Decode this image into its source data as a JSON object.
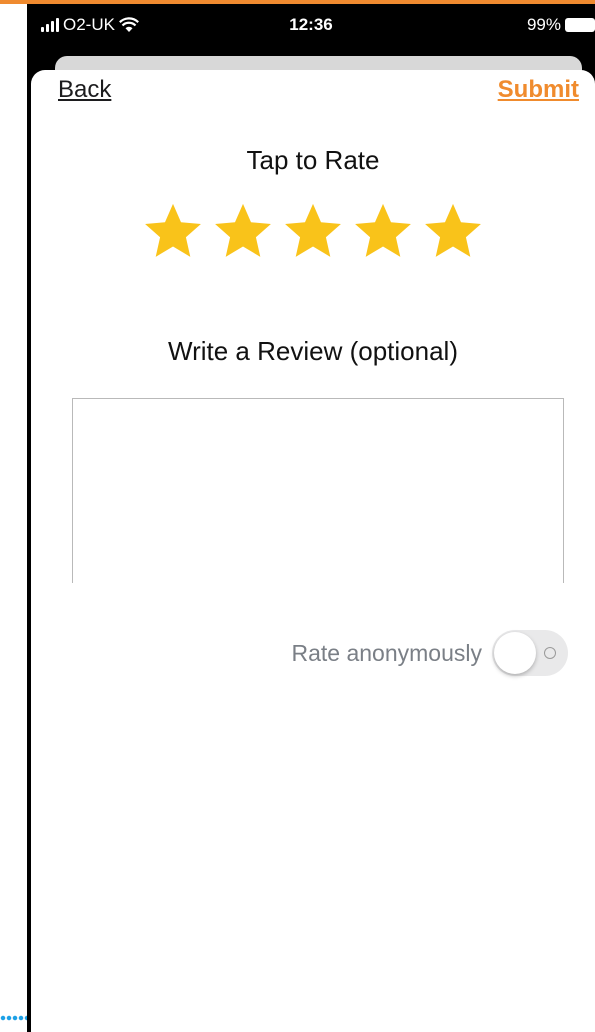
{
  "status_bar": {
    "carrier": "O2-UK",
    "time": "12:36",
    "battery": "99%"
  },
  "nav": {
    "back_label": "Back",
    "submit_label": "Submit"
  },
  "rating": {
    "title": "Tap to Rate",
    "value": 5,
    "max": 5,
    "star_color": "#f9c31a"
  },
  "review": {
    "title": "Write a Review (optional)",
    "value": ""
  },
  "anonymous": {
    "label": "Rate anonymously",
    "enabled": false
  },
  "colors": {
    "accent": "#f08b2d",
    "star": "#f9c31a"
  }
}
